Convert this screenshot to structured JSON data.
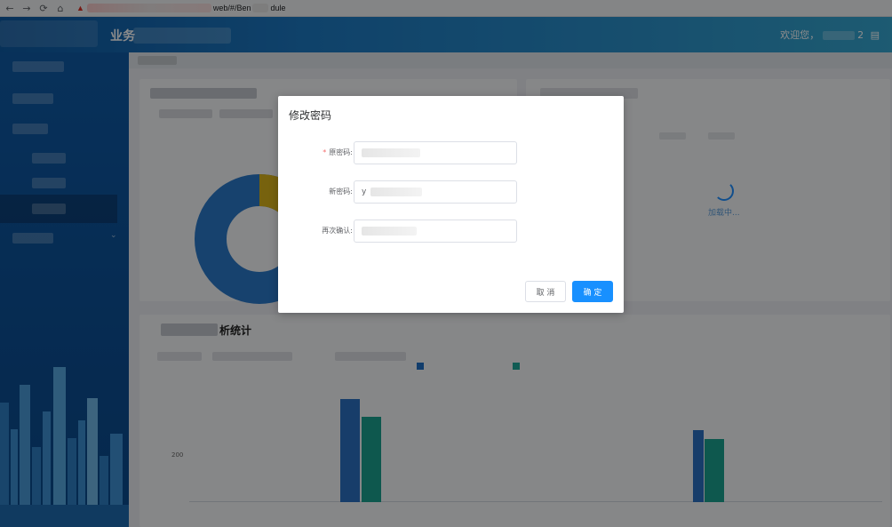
{
  "browser": {
    "back_icon": "arrow-left-icon",
    "forward_icon": "arrow-right-icon",
    "reload_icon": "reload-icon",
    "home_icon": "home-icon",
    "url_visible": "web/#/Ben",
    "url_tail": "dule"
  },
  "header": {
    "title": "业务",
    "user_text": "欢迎您，",
    "user_suffix": "2"
  },
  "content": {
    "bottom_card_title": "析统计",
    "axis_label": "200",
    "loading_text": "加载中..."
  },
  "dialog": {
    "title": "修改密码",
    "fields": [
      {
        "label": "原密码:",
        "required": true
      },
      {
        "label": "新密码:",
        "required": false
      },
      {
        "label": "再次确认:",
        "required": false
      }
    ],
    "new_password_prefix": "y",
    "cancel_label": "取 消",
    "confirm_label": "确 定"
  },
  "colors": {
    "primary": "#1890ff",
    "header_start": "#0e5aa3",
    "header_end": "#35a6cf",
    "sidebar": "#0b4f95"
  }
}
